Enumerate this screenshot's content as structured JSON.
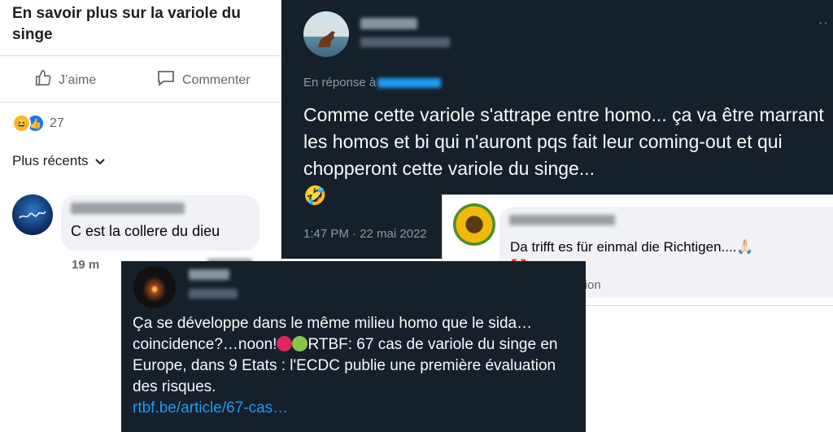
{
  "facebook_post": {
    "title": "En savoir plus sur la variole du singe",
    "like_label": "J’aime",
    "comment_label": "Commenter",
    "reaction_count": "27",
    "sort_label": "Plus récents",
    "comment": {
      "text": "C est la collere du dieu",
      "time": "19 m"
    }
  },
  "twitter_post": {
    "reply_prefix": "En réponse à",
    "text": "Comme cette variole s'attrape entre homo... ça va être marrant les homos et bi qui n'auront pqs fait leur coming-out et qui chopperont cette variole du singe...",
    "emoji": "🤣",
    "time": "1:47 PM · 22 mai 2022"
  },
  "german_comment": {
    "text": "Da trifft es für einmal die Richtigen....🙏🏻",
    "emoji": "🤡",
    "translate_label": "Voir la traduction"
  },
  "twitter_post_2": {
    "text_part1": "Ça se développe dans le même milieu homo que le sida…coincidence?…noon!",
    "text_part2": "RTBF: 67 cas de variole du singe en Europe, dans 9 Etats : l'ECDC publie une première évaluation des risques.",
    "link": "rtbf.be/article/67-cas…"
  },
  "colors": {
    "twitter_bg": "#15202b",
    "twitter_link": "#1d9bf0",
    "facebook_bubble": "#f0f2f5"
  }
}
